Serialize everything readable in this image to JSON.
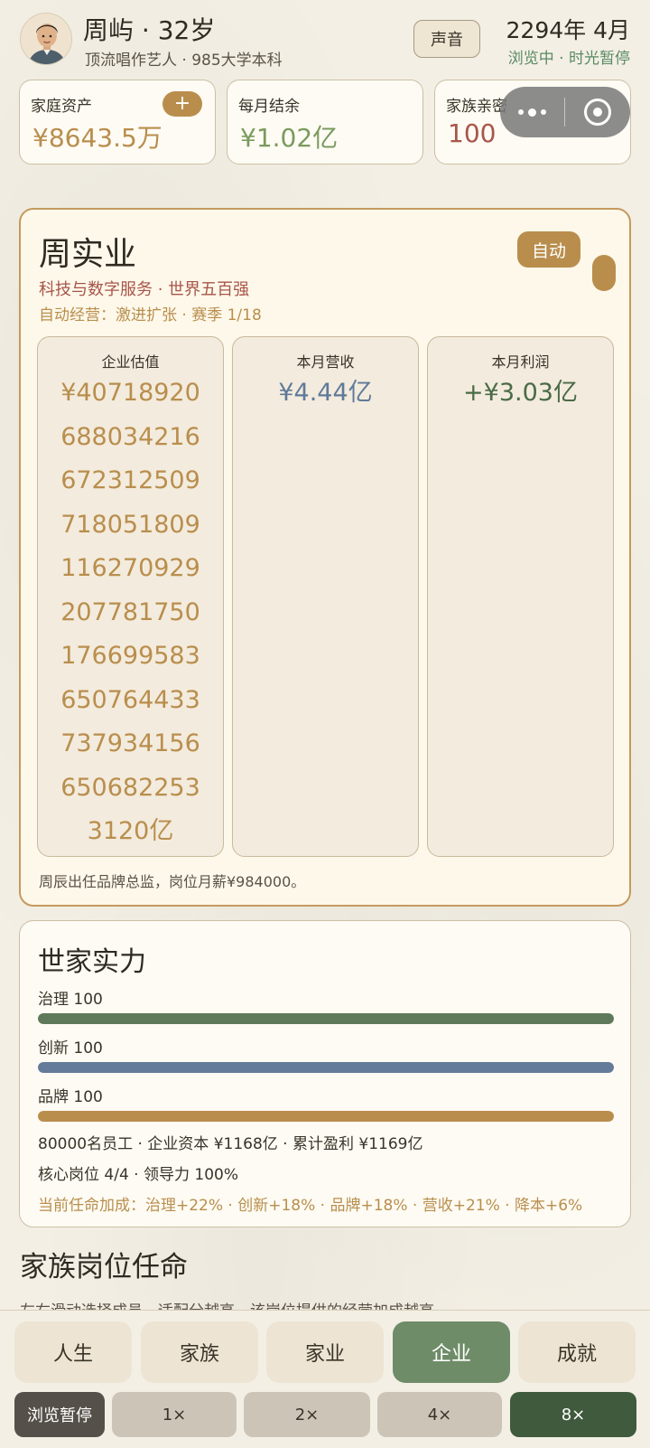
{
  "header": {
    "name_age": "周屿 · 32岁",
    "profile": "顶流唱作艺人 · 985大学本科",
    "sound_label": "声音",
    "date": "2294年 4月",
    "state": "浏览中 · 时光暂停"
  },
  "stats": [
    {
      "label": "家庭资产",
      "value": "¥8643.5万",
      "color": "#b98e4d"
    },
    {
      "label": "每月结余",
      "value": "¥1.02亿",
      "color": "#7a9a5e"
    },
    {
      "label": "家族亲密",
      "value": "100",
      "color": "#a8554a"
    }
  ],
  "add_button": "+",
  "enterprise": {
    "name": "周实业",
    "auto_label": "自动",
    "category": "科技与数字服务 · 世界五百强",
    "mode": "自动经营：激进扩张 · 赛季 1/18",
    "metrics": [
      {
        "label": "企业估值",
        "lines": [
          "¥40718920",
          "688034216",
          "672312509",
          "718051809",
          "116270929",
          "207781750",
          "176699583",
          "650764433",
          "737934156",
          "650682253",
          "3120亿"
        ],
        "color": "#b98e4d"
      },
      {
        "label": "本月营收",
        "lines": [
          "¥4.44亿"
        ],
        "color": "#5f7a9a"
      },
      {
        "label": "本月利润",
        "lines": [
          "+¥3.03亿"
        ],
        "color": "#4a6b47"
      }
    ],
    "note": "周辰出任品牌总监，岗位月薪¥984000。"
  },
  "power": {
    "title": "世家实力",
    "bars": [
      {
        "label": "治理 100",
        "value": 1.0,
        "color": "#5e7a5a"
      },
      {
        "label": "创新 100",
        "value": 1.0,
        "color": "#647b9a"
      },
      {
        "label": "品牌 100",
        "value": 1.0,
        "color": "#b98e4d"
      }
    ],
    "info1": "80000名员工 · 企业资本 ¥1168亿 · 累计盈利 ¥1169亿",
    "info2": "核心岗位 4/4 · 领导力 100%",
    "info3": "当前任命加成：治理+22% · 创新+18% · 品牌+18% · 营收+21% · 降本+6%"
  },
  "family": {
    "title": "家族岗位任命",
    "hint": "左右滑动选择成员，适配分越高，该岗位提供的经营加成越高"
  },
  "tabs": [
    {
      "label": "人生",
      "active": false
    },
    {
      "label": "家族",
      "active": false
    },
    {
      "label": "家业",
      "active": false
    },
    {
      "label": "企业",
      "active": true
    },
    {
      "label": "成就",
      "active": false
    }
  ],
  "speeds": {
    "pause": "浏览暂停",
    "options": [
      "1×",
      "2×",
      "4×",
      "8×"
    ],
    "active": "8×"
  }
}
